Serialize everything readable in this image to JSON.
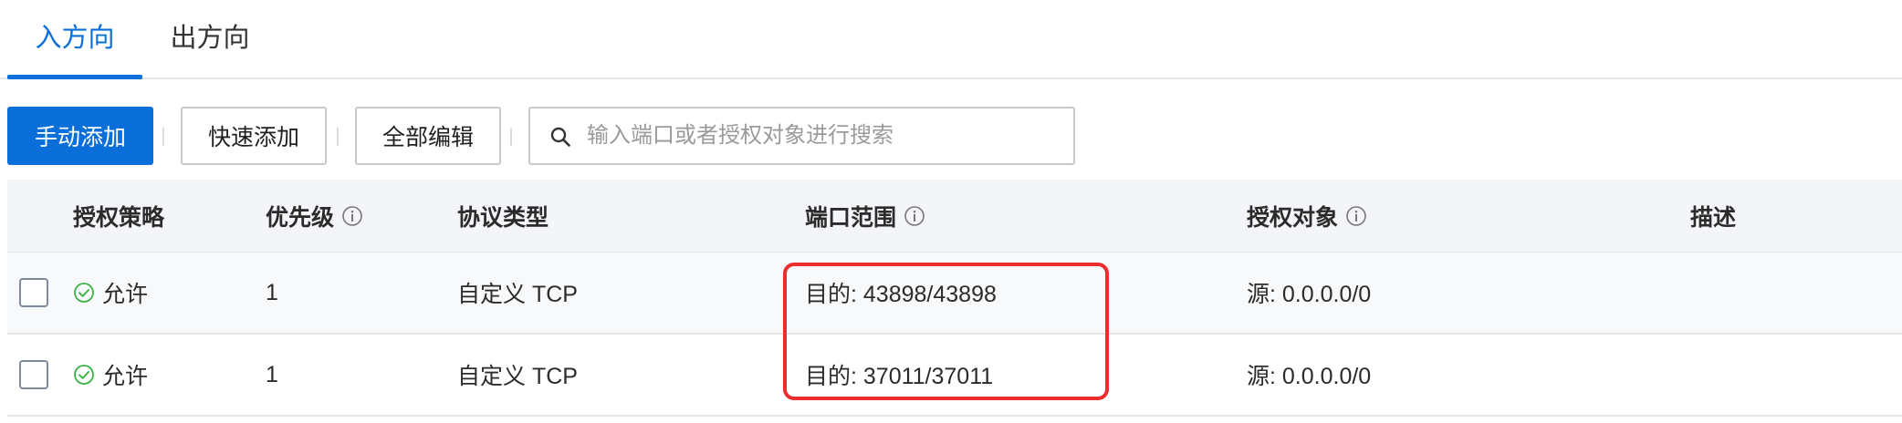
{
  "tabs": [
    {
      "label": "入方向",
      "active": true
    },
    {
      "label": "出方向",
      "active": false
    }
  ],
  "toolbar": {
    "manual_add_label": "手动添加",
    "quick_add_label": "快速添加",
    "edit_all_label": "全部编辑"
  },
  "search": {
    "placeholder": "输入端口或者授权对象进行搜索",
    "value": ""
  },
  "table": {
    "columns": [
      "授权策略",
      "优先级",
      "协议类型",
      "端口范围",
      "授权对象",
      "描述"
    ],
    "rows": [
      {
        "policy": "允许",
        "priority": "1",
        "protocol": "自定义 TCP",
        "port": "目的: 43898/43898",
        "object": "源: 0.0.0.0/0",
        "desc": ""
      },
      {
        "policy": "允许",
        "priority": "1",
        "protocol": "自定义 TCP",
        "port": "目的: 37011/37011",
        "object": "源: 0.0.0.0/0",
        "desc": ""
      }
    ]
  },
  "icons": {
    "search": "search-icon",
    "info": "info-icon",
    "allow": "check-circle-icon"
  },
  "colors": {
    "accent": "#0a6fd8",
    "allow_green": "#3bb346",
    "highlight_red": "#ec2d2d",
    "header_bg": "#f3f5f8"
  }
}
